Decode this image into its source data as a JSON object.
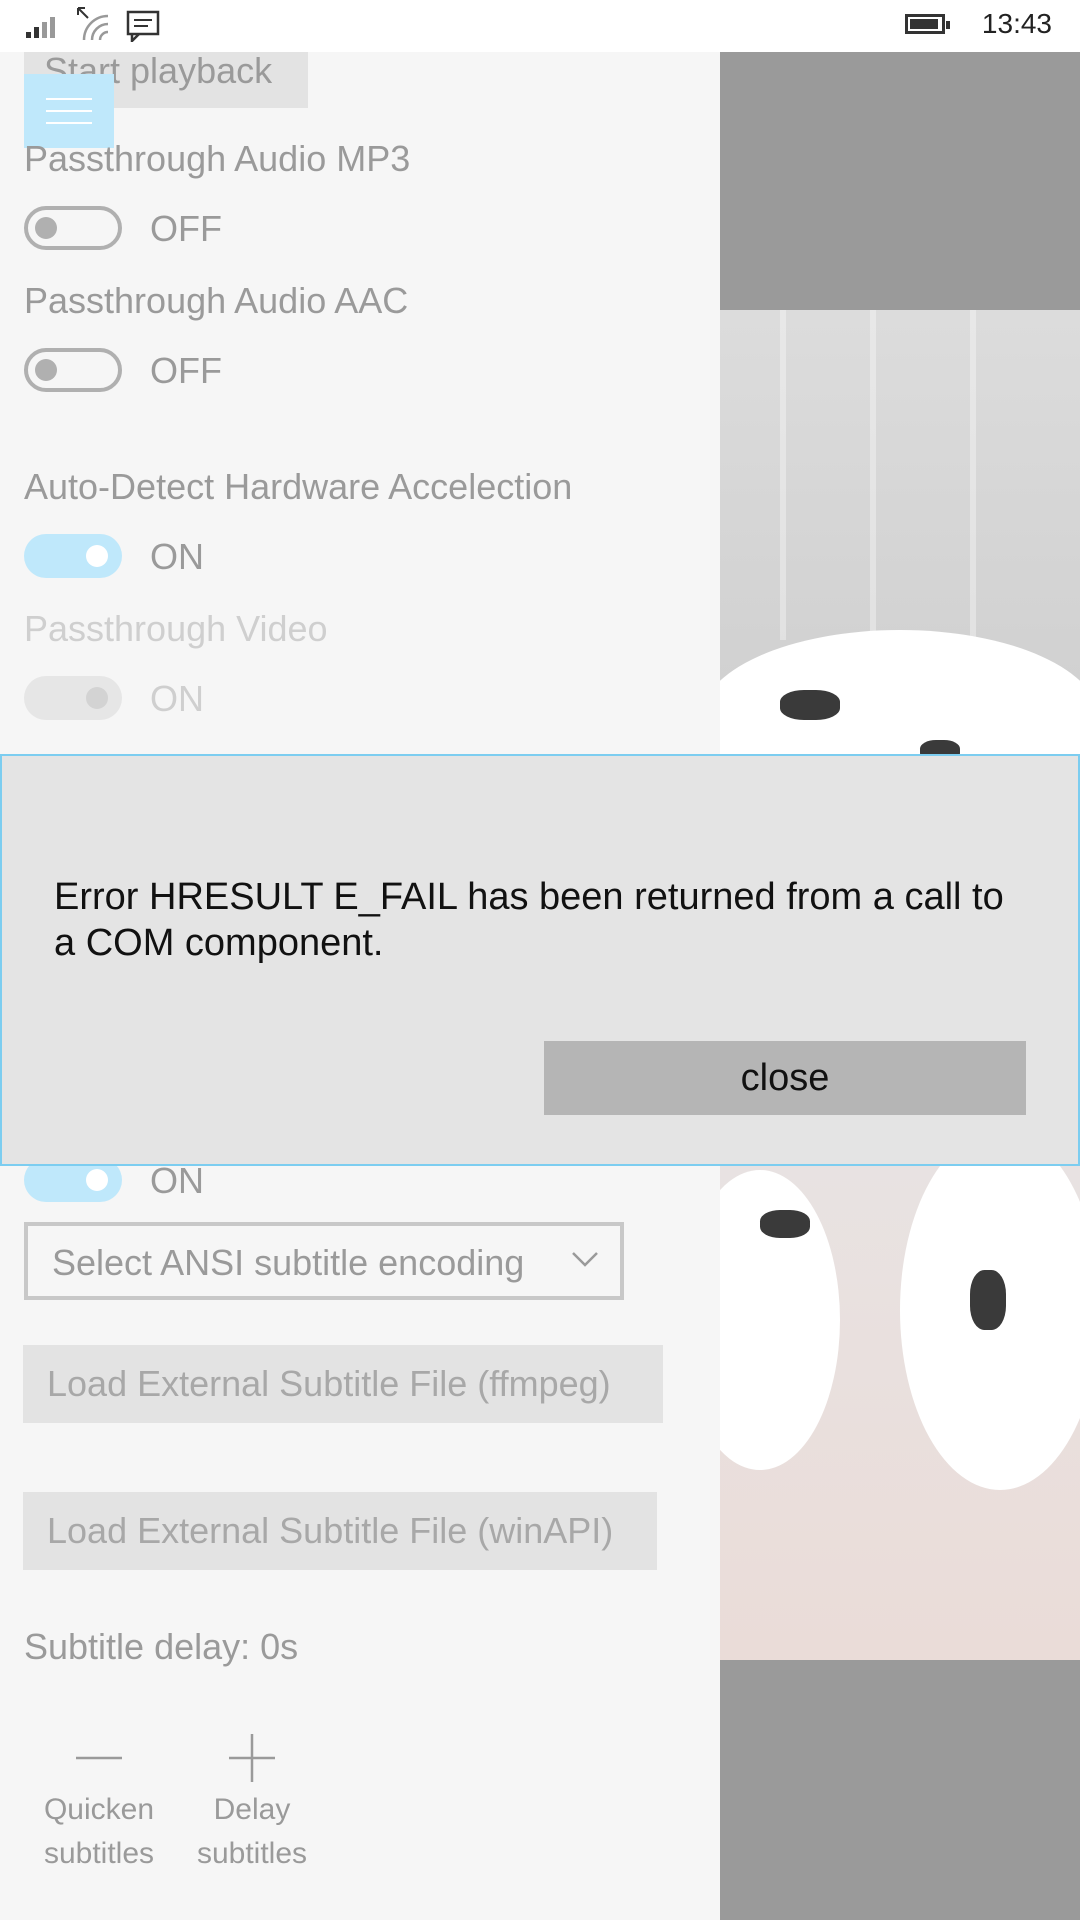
{
  "status_bar": {
    "time": "13:43",
    "icons": [
      "signal-icon",
      "wifi-icon",
      "message-icon",
      "battery-icon"
    ]
  },
  "settings": {
    "start_playback_label": "Start playback",
    "passthrough_mp3": {
      "label": "Passthrough Audio MP3",
      "state": "OFF"
    },
    "passthrough_aac": {
      "label": "Passthrough Audio AAC",
      "state": "OFF"
    },
    "auto_detect_hw": {
      "label": "Auto-Detect Hardware Accelection",
      "state": "ON"
    },
    "passthrough_video": {
      "label": "Passthrough Video",
      "state": "ON"
    },
    "hidden_toggle": {
      "state": "ON"
    },
    "ansi_encoding_placeholder": "Select ANSI subtitle encoding",
    "load_subtitle_ffmpeg": "Load External Subtitle File (ffmpeg)",
    "load_subtitle_winapi": "Load External Subtitle File (winAPI)",
    "subtitle_delay": "Subtitle delay: 0s"
  },
  "app_bar": {
    "quicken_label_1": "Quicken",
    "quicken_label_2": "subtitles",
    "delay_label_1": "Delay",
    "delay_label_2": "subtitles"
  },
  "dialog": {
    "message": "Error HRESULT E_FAIL has been returned from a call to a COM component.",
    "close_label": "close"
  },
  "colors": {
    "accent": "#bfe8fb",
    "dialog_border": "#7ccdf0",
    "dialog_bg": "#e4e4e4",
    "close_button": "#b5b5b5"
  }
}
